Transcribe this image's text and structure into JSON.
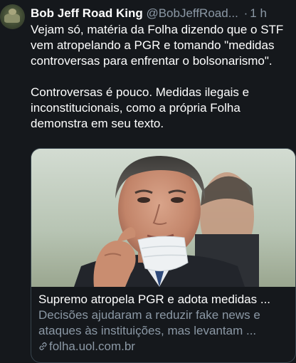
{
  "tweet": {
    "display_name": "Bob Jeff Road King",
    "handle": "@BobJeffRoad...",
    "separator": "·",
    "time": "1 h",
    "paragraphs": [
      "Vejam só, matéria da Folha dizendo que o STF vem atropelando a PGR e tomando \"medidas controversas para enfrentar o bolsonarismo\".",
      "Controversas é pouco. Medidas ilegais e inconstitucionais, como a própria Folha demonstra em seu texto."
    ]
  },
  "card": {
    "title": "Supremo atropela PGR e adota medidas ...",
    "description_lines": [
      "Decisões ajudaram a reduzir fake news e",
      "ataques às instituições, mas levantam ..."
    ],
    "domain": "folha.uol.com.br",
    "image_icon": "news-photo-man-removing-mask"
  },
  "colors": {
    "background": "#15181c",
    "primary_text": "#ffffff",
    "secondary_text": "#8b98a5",
    "card_border": "#38444d"
  }
}
